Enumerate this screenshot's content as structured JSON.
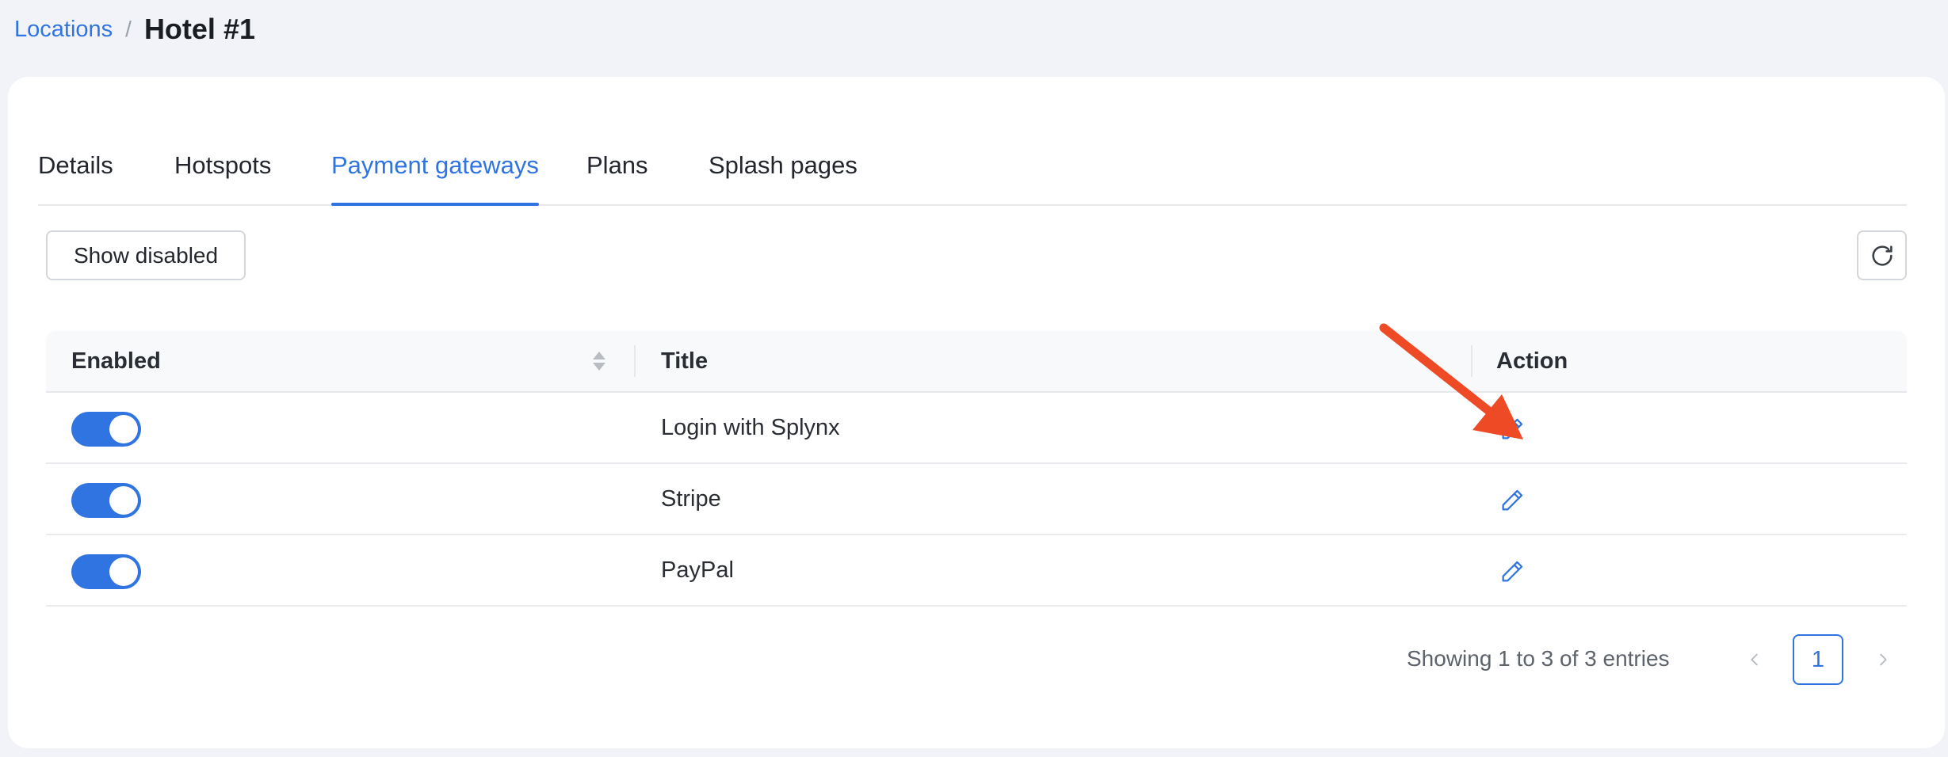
{
  "breadcrumb": {
    "parent": "Locations",
    "separator": "/",
    "current": "Hotel #1"
  },
  "tabs": [
    {
      "label": "Details",
      "active": false
    },
    {
      "label": "Hotspots",
      "active": false
    },
    {
      "label": "Payment gateways",
      "active": true
    },
    {
      "label": "Plans",
      "active": false
    },
    {
      "label": "Splash pages",
      "active": false
    }
  ],
  "toolbar": {
    "show_disabled_label": "Show disabled",
    "refresh_icon": "refresh-icon"
  },
  "table": {
    "columns": [
      "Enabled",
      "Title",
      "Action"
    ],
    "rows": [
      {
        "enabled": true,
        "title": "Login with Splynx",
        "action_icon": "pencil-icon"
      },
      {
        "enabled": true,
        "title": "Stripe",
        "action_icon": "pencil-icon"
      },
      {
        "enabled": true,
        "title": "PayPal",
        "action_icon": "pencil-icon"
      }
    ]
  },
  "pagination": {
    "summary": "Showing 1 to 3 of 3 entries",
    "current_page": "1"
  },
  "annotation": {
    "arrow_color": "#ef4a26"
  },
  "colors": {
    "accent": "#2f74e0",
    "background": "#f1f3f8"
  }
}
